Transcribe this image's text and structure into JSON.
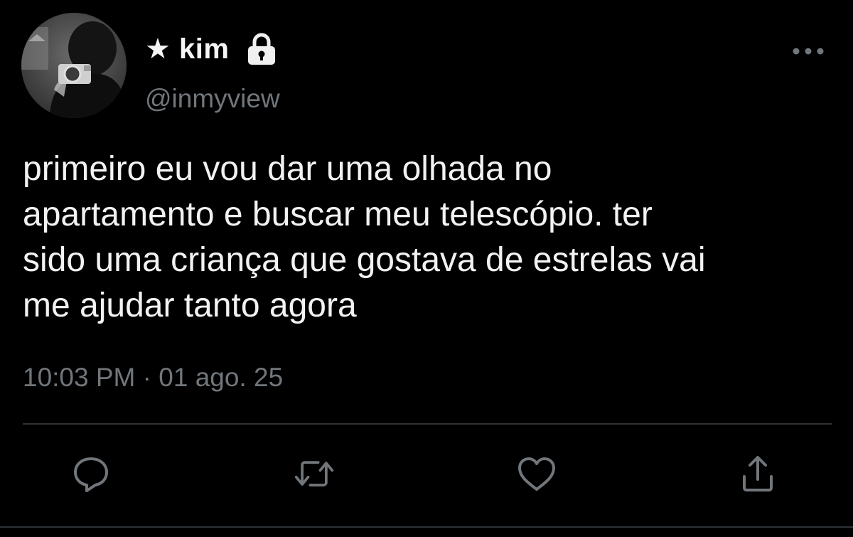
{
  "user": {
    "display_name": "★ kim",
    "handle": "@inmyview",
    "avatar": "avatar-photo",
    "protected_icon": "lock-icon"
  },
  "menu": {
    "icon": "more-horizontal-icon"
  },
  "tweet": {
    "lines": [
      "primeiro eu vou dar uma olhada no",
      "apartamento e buscar meu telescópio. ter",
      "sido uma criança que gostava de estrelas vai",
      "me ajudar tanto agora"
    ],
    "time": "10:03 PM",
    "separator": "·",
    "date": "01 ago. 25"
  },
  "actions": [
    {
      "icon": "reply-icon"
    },
    {
      "icon": "retweet-icon"
    },
    {
      "icon": "like-icon"
    },
    {
      "icon": "share-icon"
    }
  ],
  "colors": {
    "background": "#000000",
    "text": "#f2f2f2",
    "secondary": "#71767b",
    "divider": "#2f3336"
  }
}
